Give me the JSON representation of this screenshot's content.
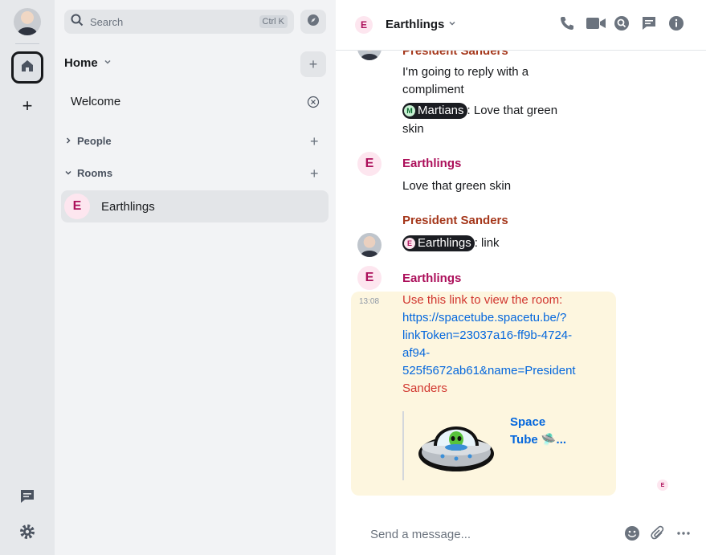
{
  "spacebar": {
    "home_label": "Home",
    "add_space_label": "+"
  },
  "roomlist": {
    "search_placeholder": "Search",
    "search_shortcut": "Ctrl K",
    "home_title": "Home",
    "home_add": "+",
    "welcome": "Welcome",
    "sections": [
      {
        "label": "People",
        "add": "+"
      },
      {
        "label": "Rooms",
        "add": "+"
      }
    ],
    "rooms": [
      {
        "avatar": "E",
        "name": "Earthlings"
      }
    ]
  },
  "header": {
    "avatar": "E",
    "room_name": "Earthlings"
  },
  "timeline": {
    "msg0": {
      "sender": "President Sanders",
      "lines": [
        "I'm going to reply with a",
        "compliment"
      ],
      "reply_pill_avatar": "M",
      "reply_pill": "Martians",
      "reply_rest_1": ": Love that green",
      "reply_rest_2": "skin"
    },
    "msg1": {
      "avatar": "E",
      "sender": "Earthlings",
      "body": "Love that green skin"
    },
    "msg2": {
      "sender": "President Sanders",
      "pill_avatar": "E",
      "pill": "Earthlings",
      "rest": ": link"
    },
    "msg3": {
      "avatar": "E",
      "sender": "Earthlings",
      "timestamp": "13:08",
      "line1": "Use this link to view the room:",
      "link_lines": [
        "https://spacetube.spacetu.be/?",
        "linkToken=23037a16-ff9b-4724-",
        "af94-",
        "525f5672ab61&name=President"
      ],
      "line_end": "Sanders",
      "preview_title_1": "Space",
      "preview_title_2": "Tube 🛸...",
      "read_receipt": "E"
    }
  },
  "composer": {
    "placeholder": "Send a message..."
  },
  "colors": {
    "accent_room": "#ac0f5a",
    "sanders": "#a5371b",
    "link": "#0467dd",
    "highlight": "#fdf6df"
  }
}
